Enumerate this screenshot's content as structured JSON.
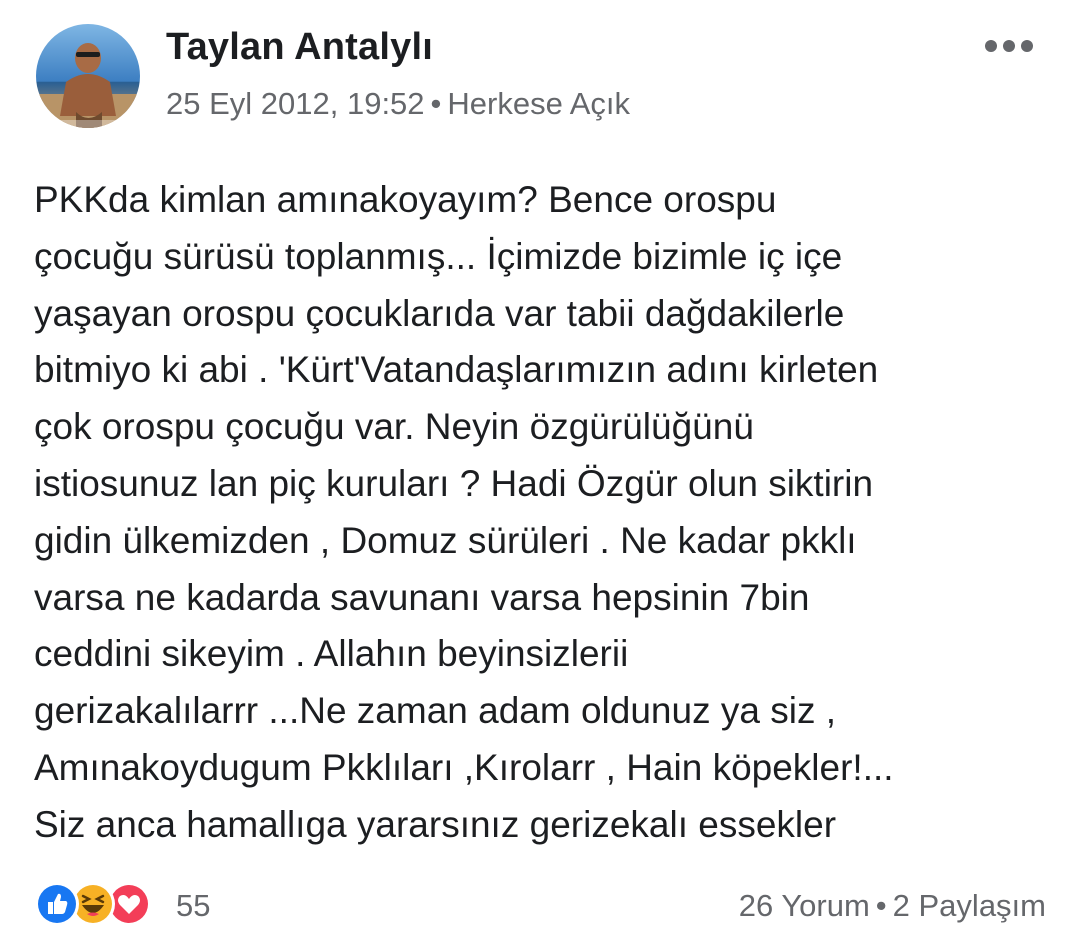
{
  "post": {
    "author_name": "Taylan Antalylı",
    "timestamp": "25 Eyl 2012, 19:52",
    "separator": "•",
    "audience": "Herkese Açık",
    "more_icon": "more-horizontal-icon",
    "body_lines": [
      "PKKda kimlan amınakoyayım? Bence orospu",
      "çocuğu sürüsü toplanmış... İçimizde bizimle iç içe",
      "yaşayan orospu çocuklarıda var tabii dağdakilerle",
      "bitmiyo ki abi . 'Kürt'Vatandaşlarımızın adını kirleten",
      "çok orospu çocuğu var. Neyin özgürülüğünü",
      "istiosunuz lan piç kuruları ? Hadi Özgür olun siktirin",
      "gidin ülkemizden , Domuz sürüleri . Ne kadar pkklı",
      "varsa ne kadarda savunanı varsa hepsinin 7bin",
      "ceddini sikeyim . Allahın beyinsizlerii",
      "gerizakalılarrr ...Ne zaman adam oldunuz ya siz ,",
      "Amınakoydugum Pkklıları ,Kırolarr , Hain köpekler!...",
      "Siz anca hamallıga yararsınız gerizekalı essekler"
    ]
  },
  "footer": {
    "reactions": [
      "like-icon",
      "haha-icon",
      "love-icon"
    ],
    "reaction_count": "55",
    "comments": "26 Yorum",
    "separator": "•",
    "shares": "2 Paylaşım"
  },
  "colors": {
    "text_primary": "#1c1e21",
    "text_secondary": "#65676b",
    "like_blue": "#1877f2",
    "haha_yellow": "#f7b125",
    "love_red": "#f33e58"
  }
}
